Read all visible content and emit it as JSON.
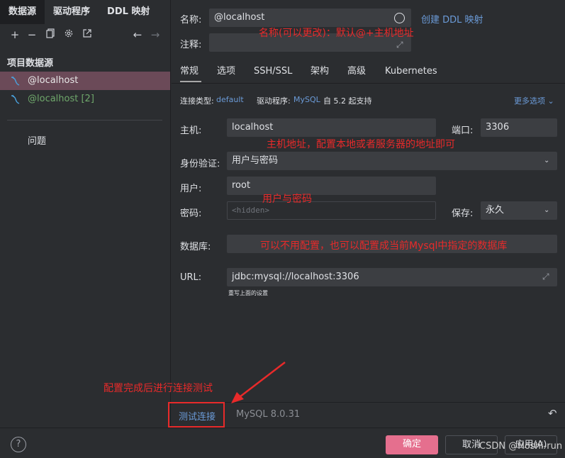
{
  "left": {
    "tabs": [
      "数据源",
      "驱动程序",
      "DDL 映射"
    ],
    "section_title": "项目数据源",
    "items": [
      {
        "label": "@localhost"
      },
      {
        "label": "@localhost [2]"
      }
    ],
    "problems": "问题"
  },
  "form": {
    "name_label": "名称:",
    "name_value": "@localhost",
    "create_ddl": "创建 DDL 映射",
    "comment_label": "注释:",
    "tabs": [
      "常规",
      "选项",
      "SSH/SSL",
      "架构",
      "高级",
      "Kubernetes"
    ],
    "conn_type_label": "连接类型:",
    "conn_type_value": "default",
    "driver_label": "驱动程序:",
    "driver_value": "MySQL",
    "driver_note": "自 5.2 起支持",
    "more_options": "更多选项",
    "host_label": "主机:",
    "host_value": "localhost",
    "port_label": "端口:",
    "port_value": "3306",
    "auth_label": "身份验证:",
    "auth_value": "用户与密码",
    "user_label": "用户:",
    "user_value": "root",
    "password_label": "密码:",
    "password_placeholder": "<hidden>",
    "save_label": "保存:",
    "save_value": "永久",
    "db_label": "数据库:",
    "url_label": "URL:",
    "url_value": "jdbc:mysql://localhost:3306",
    "url_hint": "重写上面的设置"
  },
  "annotations": {
    "name_note": "名称(可以更改)：默认@+主机地址",
    "host_note": "主机地址，配置本地或者服务器的地址即可",
    "user_note": "用户与密码",
    "db_note": "可以不用配置，也可以配置成当前Mysql中指定的数据库",
    "test_note": "配置完成后进行连接测试"
  },
  "status_bar": {
    "test_connection": "测试连接",
    "mysql_version": "MySQL 8.0.31"
  },
  "footer": {
    "help": "?",
    "ok": "确定",
    "cancel": "取消",
    "apply": "应用(A)"
  },
  "watermark": "CSDN @Hoshi-run",
  "colors": {
    "accent_primary": "#e56f8e",
    "link": "#6b9bd8",
    "annotation_red": "#e82a2a",
    "selected_row": "#6b4a58"
  }
}
